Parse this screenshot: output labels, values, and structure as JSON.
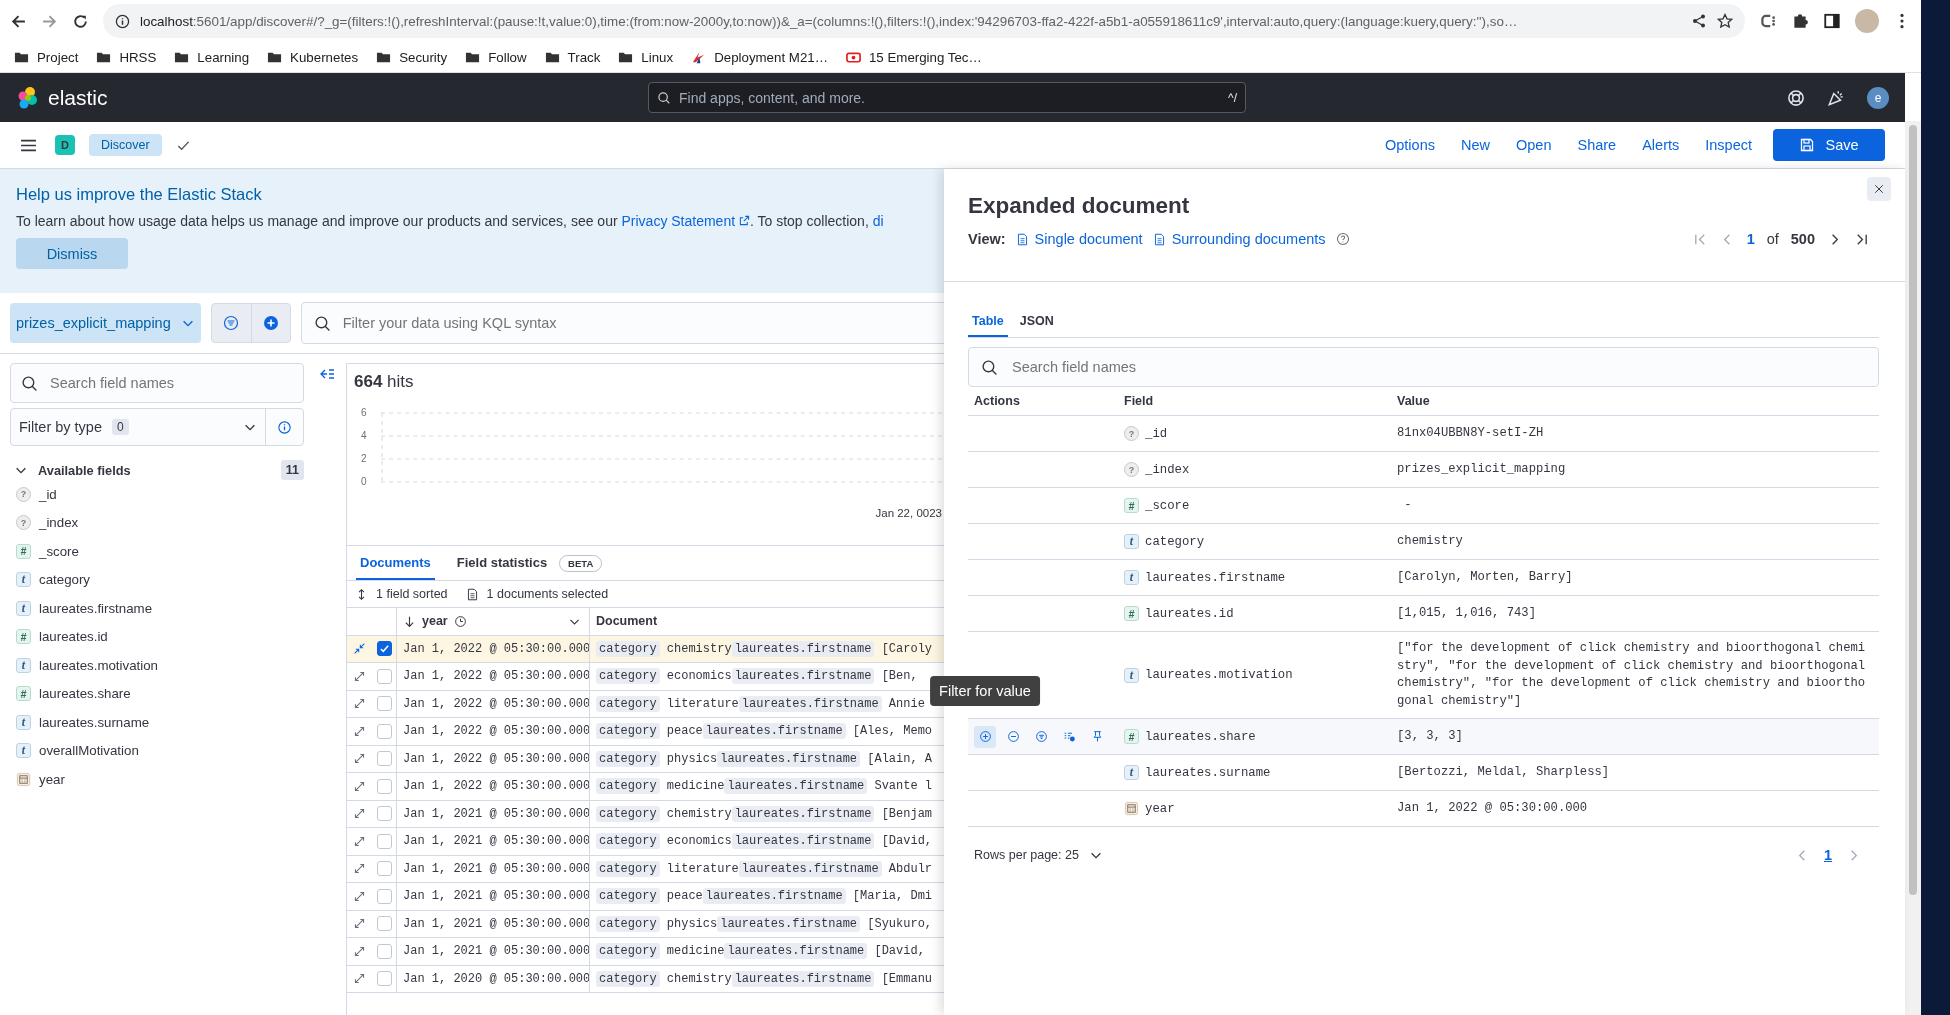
{
  "browser": {
    "url_host": "localhost",
    "url_rest": ":5601/app/discover#/?_g=(filters:!(),refreshInterval:(pause:!t,value:0),time:(from:now-2000y,to:now))&_a=(columns:!(),filters:!(),index:'94296703-ffa2-422f-a5b1-a055918611c9',interval:auto,query:(language:kuery,query:''),so…",
    "bookmarks": [
      {
        "label": "Project",
        "kind": "folder"
      },
      {
        "label": "HRSS",
        "kind": "folder"
      },
      {
        "label": "Learning",
        "kind": "folder"
      },
      {
        "label": "Kubernetes",
        "kind": "folder"
      },
      {
        "label": "Security",
        "kind": "folder"
      },
      {
        "label": "Follow",
        "kind": "folder"
      },
      {
        "label": "Track",
        "kind": "folder"
      },
      {
        "label": "Linux",
        "kind": "folder"
      },
      {
        "label": "Deployment M21…",
        "kind": "site-a"
      },
      {
        "label": "15 Emerging Tec…",
        "kind": "site-b"
      }
    ]
  },
  "header": {
    "logo": "elastic",
    "search_placeholder": "Find apps, content, and more.",
    "shortcut": "^/",
    "avatar": "e"
  },
  "subheader": {
    "space": "D",
    "breadcrumb": "Discover",
    "links": [
      "Options",
      "New",
      "Open",
      "Share",
      "Alerts",
      "Inspect"
    ],
    "save": "Save"
  },
  "banner": {
    "title": "Help us improve the Elastic Stack",
    "text_before": "To learn about how usage data helps us manage and improve our products and services, see our ",
    "link": "Privacy Statement",
    "text_after": ". To stop collection, ",
    "link_cut": "di",
    "dismiss": "Dismiss"
  },
  "data_view": "prizes_explicit_mapping",
  "query_placeholder": "Filter your data using KQL syntax",
  "sidebar": {
    "search_placeholder": "Search field names",
    "filter_label": "Filter by type",
    "filter_count": "0",
    "section": "Available fields",
    "section_count": "11",
    "expanded": true,
    "fields": [
      {
        "name": "_id",
        "kind": "unknown",
        "glyph": "?"
      },
      {
        "name": "_index",
        "kind": "unknown",
        "glyph": "?"
      },
      {
        "name": "_score",
        "kind": "number",
        "glyph": "#"
      },
      {
        "name": "category",
        "kind": "text",
        "glyph": "t"
      },
      {
        "name": "laureates.firstname",
        "kind": "text",
        "glyph": "t"
      },
      {
        "name": "laureates.id",
        "kind": "number",
        "glyph": "#"
      },
      {
        "name": "laureates.motivation",
        "kind": "text",
        "glyph": "t"
      },
      {
        "name": "laureates.share",
        "kind": "number",
        "glyph": "#"
      },
      {
        "name": "laureates.surname",
        "kind": "text",
        "glyph": "t"
      },
      {
        "name": "overallMotivation",
        "kind": "text",
        "glyph": "t"
      },
      {
        "name": "year",
        "kind": "date"
      }
    ]
  },
  "hits": {
    "count": "664",
    "label": "hits"
  },
  "histogram": {
    "y_ticks": [
      "6",
      "4",
      "2",
      "0"
    ],
    "x_label": "Jan 22, 0023"
  },
  "doc_tabs": [
    {
      "label": "Documents",
      "selected": true
    },
    {
      "label": "Field statistics",
      "selected": false,
      "badge": "BETA"
    }
  ],
  "sort_info": "1 field sorted",
  "selection_info": "1 documents selected",
  "table": {
    "columns": [
      "year",
      "Document"
    ],
    "rows": [
      {
        "date": "Jan 1, 2022 @ 05:30:00.000",
        "checked": true,
        "expanded": true,
        "doc": [
          {
            "key": "category",
            "value": "chemistry"
          },
          {
            "key": "laureates.firstname",
            "value": "[Caroly"
          }
        ]
      },
      {
        "date": "Jan 1, 2022 @ 05:30:00.000",
        "checked": false,
        "expanded": false,
        "doc": [
          {
            "key": "category",
            "value": "economics"
          },
          {
            "key": "laureates.firstname",
            "value": "[Ben,"
          }
        ]
      },
      {
        "date": "Jan 1, 2022 @ 05:30:00.000",
        "checked": false,
        "expanded": false,
        "doc": [
          {
            "key": "category",
            "value": "literature"
          },
          {
            "key": "laureates.firstname",
            "value": "Annie"
          }
        ]
      },
      {
        "date": "Jan 1, 2022 @ 05:30:00.000",
        "checked": false,
        "expanded": false,
        "doc": [
          {
            "key": "category",
            "value": "peace"
          },
          {
            "key": "laureates.firstname",
            "value": "[Ales, Memo"
          }
        ]
      },
      {
        "date": "Jan 1, 2022 @ 05:30:00.000",
        "checked": false,
        "expanded": false,
        "doc": [
          {
            "key": "category",
            "value": "physics"
          },
          {
            "key": "laureates.firstname",
            "value": "[Alain, A"
          }
        ]
      },
      {
        "date": "Jan 1, 2022 @ 05:30:00.000",
        "checked": false,
        "expanded": false,
        "doc": [
          {
            "key": "category",
            "value": "medicine"
          },
          {
            "key": "laureates.firstname",
            "value": "Svante l"
          }
        ]
      },
      {
        "date": "Jan 1, 2021 @ 05:30:00.000",
        "checked": false,
        "expanded": false,
        "doc": [
          {
            "key": "category",
            "value": "chemistry"
          },
          {
            "key": "laureates.firstname",
            "value": "[Benjam"
          }
        ]
      },
      {
        "date": "Jan 1, 2021 @ 05:30:00.000",
        "checked": false,
        "expanded": false,
        "doc": [
          {
            "key": "category",
            "value": "economics"
          },
          {
            "key": "laureates.firstname",
            "value": "[David,"
          }
        ]
      },
      {
        "date": "Jan 1, 2021 @ 05:30:00.000",
        "checked": false,
        "expanded": false,
        "doc": [
          {
            "key": "category",
            "value": "literature"
          },
          {
            "key": "laureates.firstname",
            "value": "Abdulr"
          }
        ]
      },
      {
        "date": "Jan 1, 2021 @ 05:30:00.000",
        "checked": false,
        "expanded": false,
        "doc": [
          {
            "key": "category",
            "value": "peace"
          },
          {
            "key": "laureates.firstname",
            "value": "[Maria, Dmi"
          }
        ]
      },
      {
        "date": "Jan 1, 2021 @ 05:30:00.000",
        "checked": false,
        "expanded": false,
        "doc": [
          {
            "key": "category",
            "value": "physics"
          },
          {
            "key": "laureates.firstname",
            "value": "[Syukuro,"
          }
        ]
      },
      {
        "date": "Jan 1, 2021 @ 05:30:00.000",
        "checked": false,
        "expanded": false,
        "doc": [
          {
            "key": "category",
            "value": "medicine"
          },
          {
            "key": "laureates.firstname",
            "value": "[David,"
          }
        ]
      },
      {
        "date": "Jan 1, 2020 @ 05:30:00.000",
        "checked": false,
        "expanded": false,
        "doc": [
          {
            "key": "category",
            "value": "chemistry"
          },
          {
            "key": "laureates.firstname",
            "value": "[Emmanu"
          }
        ]
      }
    ]
  },
  "flyout": {
    "title": "Expanded document",
    "view_label": "View:",
    "view_links": [
      "Single document",
      "Surrounding documents"
    ],
    "page": "1",
    "of": "of",
    "total": "500",
    "tabs": [
      {
        "label": "Table",
        "selected": true
      },
      {
        "label": "JSON",
        "selected": false
      }
    ],
    "search_placeholder": "Search field names",
    "columns": [
      "Actions",
      "Field",
      "Value"
    ],
    "rows": [
      {
        "field": "_id",
        "kind": "unknown",
        "glyph": "?",
        "value": "81nx04UBBN8Y-setI-ZH",
        "hovered": false
      },
      {
        "field": "_index",
        "kind": "unknown",
        "glyph": "?",
        "value": "prizes_explicit_mapping",
        "hovered": false
      },
      {
        "field": "_score",
        "kind": "number",
        "glyph": "#",
        "value": " -",
        "hovered": false
      },
      {
        "field": "category",
        "kind": "text",
        "glyph": "t",
        "value": "chemistry",
        "hovered": false
      },
      {
        "field": "laureates.firstname",
        "kind": "text",
        "glyph": "t",
        "value": "[Carolyn, Morten, Barry]",
        "hovered": false
      },
      {
        "field": "laureates.id",
        "kind": "number",
        "glyph": "#",
        "value": "[1,015, 1,016, 743]",
        "hovered": false
      },
      {
        "field": "laureates.motivation",
        "kind": "text",
        "glyph": "t",
        "value": "[\"for the development of click chemistry and bioorthogonal chemistry\", \"for the development of click chemistry and bioorthogonal chemistry\", \"for the development of click chemistry and bioorthogonal chemistry\"]",
        "hovered": false
      },
      {
        "field": "laureates.share",
        "kind": "number",
        "glyph": "#",
        "value": "[3, 3, 3]",
        "hovered": true
      },
      {
        "field": "laureates.surname",
        "kind": "text",
        "glyph": "t",
        "value": "[Bertozzi, Meldal, Sharpless]",
        "hovered": false
      },
      {
        "field": "year",
        "kind": "date",
        "value": "Jan 1, 2022 @ 05:30:00.000",
        "hovered": false
      }
    ],
    "rows_per_page": "Rows per page: 25",
    "current_page": "1",
    "tooltip": "Filter for value"
  }
}
